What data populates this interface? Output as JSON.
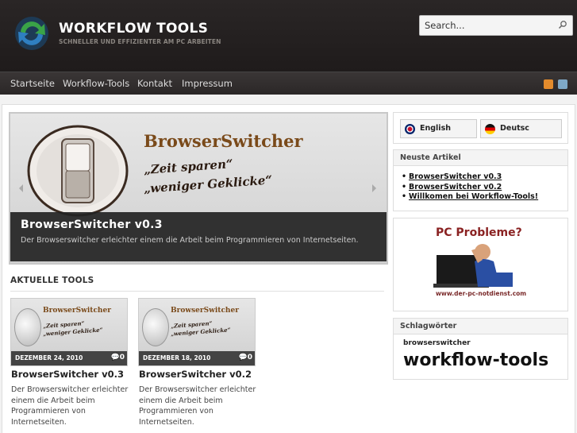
{
  "header": {
    "title": "WORKFLOW TOOLS",
    "tagline": "SCHNELLER UND EFFIZIENTER AM PC ARBEITEN",
    "search_placeholder": "Search..."
  },
  "nav": {
    "items": [
      "Startseite",
      "Workflow-Tools",
      "Kontakt",
      "Impressum"
    ]
  },
  "slider": {
    "image_title": "BrowserSwitcher",
    "image_quote_1": "„Zeit sparen“",
    "image_quote_2": "„weniger Geklicke“",
    "caption_title": "BrowserSwitcher v0.3",
    "caption_text": "Der Browserswitcher erleichter einem die Arbeit beim Programmieren von Internetseiten."
  },
  "section": {
    "title": "AKTUELLE TOOLS"
  },
  "cards": [
    {
      "thumb_title": "BrowserSwitcher",
      "thumb_quote_1": "„Zeit sparen“",
      "thumb_quote_2": "„weniger Geklicke“",
      "date": "DEZEMBER 24, 2010",
      "comments": "0",
      "title": "BrowserSwitcher v0.3",
      "excerpt": "Der Browserswitcher erleichter einem die Arbeit beim Programmieren von Internetseiten."
    },
    {
      "thumb_title": "BrowserSwitcher",
      "thumb_quote_1": "„Zeit sparen“",
      "thumb_quote_2": "„weniger Geklicke“",
      "date": "DEZEMBER 18, 2010",
      "comments": "0",
      "title": "BrowserSwitcher v0.2",
      "excerpt": "Der Browserswitcher erleichter einem die Arbeit beim Programmieren von Internetseiten."
    }
  ],
  "sidebar": {
    "languages": [
      "English",
      "Deutsc"
    ],
    "recent_heading": "Neuste Artikel",
    "recent_items": [
      "BrowserSwitcher v0.3",
      "BrowserSwitcher v0.2",
      "Willkomen bei Workflow-Tools!"
    ],
    "ad_title": "PC Probleme?",
    "ad_url": "www.der-pc-notdienst.com",
    "tags_heading": "Schlagwörter",
    "tags": [
      "browserswitcher",
      "workflow-tools"
    ]
  },
  "colors": {
    "header_bg": "#231f1f",
    "nav_bg": "#332f2f",
    "accent_brown": "#7a4a1a",
    "ad_red": "#8a2222"
  }
}
